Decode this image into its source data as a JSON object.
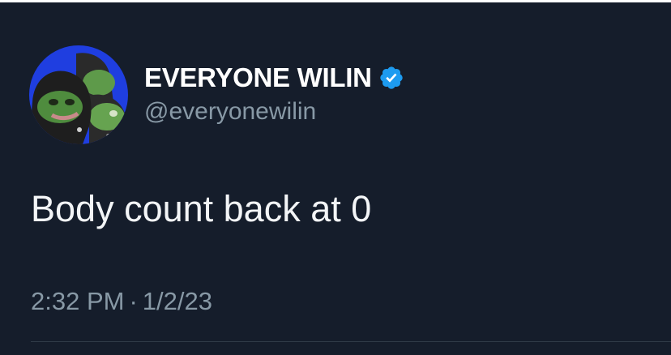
{
  "tweet": {
    "display_name": "EVERYONE WILIN",
    "handle": "@everyonewilin",
    "verified": true,
    "text": "Body count back at 0",
    "time": "2:32 PM",
    "separator": "·",
    "date": "1/2/23"
  },
  "icons": {
    "verified": "verified-badge-icon",
    "avatar": "avatar-image"
  },
  "colors": {
    "background": "#151d2b",
    "name": "#ffffff",
    "secondary_text": "#8899a6",
    "verified": "#1d9bf0",
    "avatar_bg": "#1f3ee0"
  }
}
